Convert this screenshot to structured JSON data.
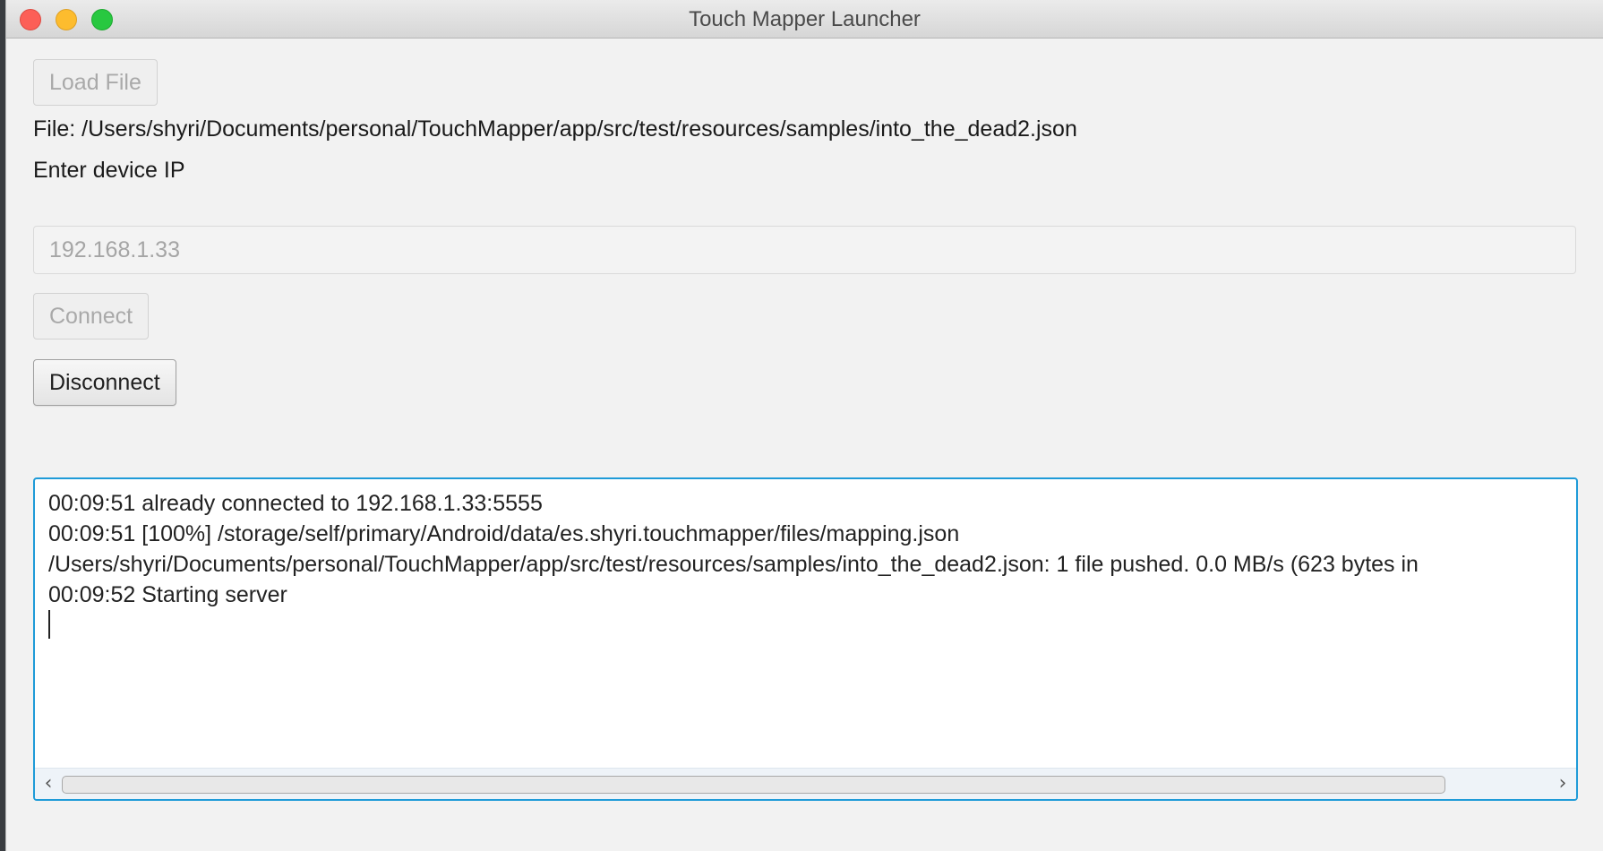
{
  "window": {
    "title": "Touch Mapper Launcher"
  },
  "toolbar": {
    "load_file_label": "Load File",
    "connect_label": "Connect",
    "disconnect_label": "Disconnect"
  },
  "file": {
    "path_text": "File: /Users/shyri/Documents/personal/TouchMapper/app/src/test/resources/samples/into_the_dead2.json"
  },
  "device": {
    "prompt": "Enter device IP",
    "ip_placeholder": "192.168.1.33",
    "ip_value": ""
  },
  "log": {
    "lines": [
      "00:09:51 already connected to 192.168.1.33:5555",
      "00:09:51 [100%] /storage/self/primary/Android/data/es.shyri.touchmapper/files/mapping.json",
      "/Users/shyri/Documents/personal/TouchMapper/app/src/test/resources/samples/into_the_dead2.json: 1 file pushed. 0.0 MB/s (623 bytes in",
      "00:09:52 Starting server"
    ]
  },
  "icons": {
    "scroll_left": "chevron-left-icon",
    "scroll_right": "chevron-right-icon"
  },
  "colors": {
    "close": "#fc5f57",
    "minimize": "#fdbc2e",
    "maximize": "#28c840",
    "focus_accent": "#1f9bd8"
  }
}
